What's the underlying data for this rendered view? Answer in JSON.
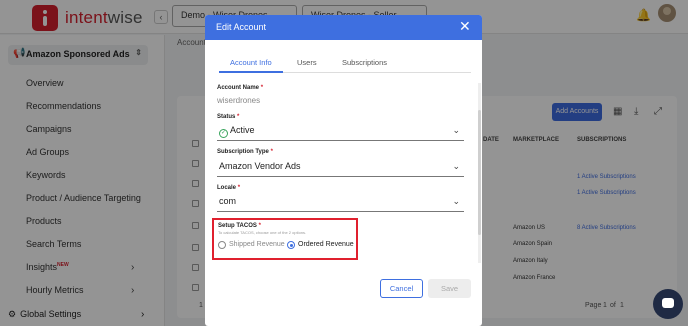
{
  "brand": {
    "name_part1": "intent",
    "name_part2": "wise"
  },
  "header": {
    "collapse_icon": "chevron-left-icon",
    "selector1": "Demo - Wiser Drones",
    "selector2": "Wiser Drones - Seller",
    "bell_icon": "bell-icon"
  },
  "sidebar": {
    "section": "Amazon Sponsored Ads",
    "items": [
      {
        "label": "Overview"
      },
      {
        "label": "Recommendations"
      },
      {
        "label": "Campaigns"
      },
      {
        "label": "Ad Groups"
      },
      {
        "label": "Keywords"
      },
      {
        "label": "Product / Audience Targeting"
      },
      {
        "label": "Products"
      },
      {
        "label": "Search Terms"
      },
      {
        "label": "Insights",
        "badge": "NEW"
      },
      {
        "label": "Hourly Metrics"
      }
    ],
    "global_settings": "Global Settings"
  },
  "main": {
    "breadcrumb": "Account",
    "add_accounts": "Add Accounts",
    "columns": {
      "date": "DATE",
      "marketplace": "MARKETPLACE",
      "subscriptions": "SUBSCRIPTIONS"
    },
    "subscriptions": [
      "1 Active Subscriptions",
      "1 Active Subscriptions",
      "8 Active Subscriptions"
    ],
    "marketplaces": [
      "Amazon US",
      "Amazon Spain",
      "Amazon Italy",
      "Amazon France"
    ],
    "footer_left": "1 t",
    "pagination": {
      "page_label": "Page",
      "page": "1",
      "of_label": "of",
      "total": "1"
    }
  },
  "modal": {
    "title": "Edit Account",
    "tabs": [
      "Account Info",
      "Users",
      "Subscriptions"
    ],
    "account_name_label": "Account Name",
    "account_name_value": "wiserdrones",
    "status_label": "Status",
    "status_value": "Active",
    "subscription_type_label": "Subscription Type",
    "subscription_type_value": "Amazon Vendor Ads",
    "locale_label": "Locale",
    "locale_value": "com",
    "tacos_label": "Setup TACOS",
    "tacos_help": "To calculate TACOS, choose one of the 2 options.",
    "tacos_options": [
      "Shipped Revenue",
      "Ordered Revenue"
    ],
    "tacos_selected": "Ordered Revenue",
    "cancel_label": "Cancel",
    "save_label": "Save"
  },
  "colors": {
    "brand": "#d51f2e",
    "primary": "#3e6fe0",
    "highlight_box": "#e0202e"
  }
}
